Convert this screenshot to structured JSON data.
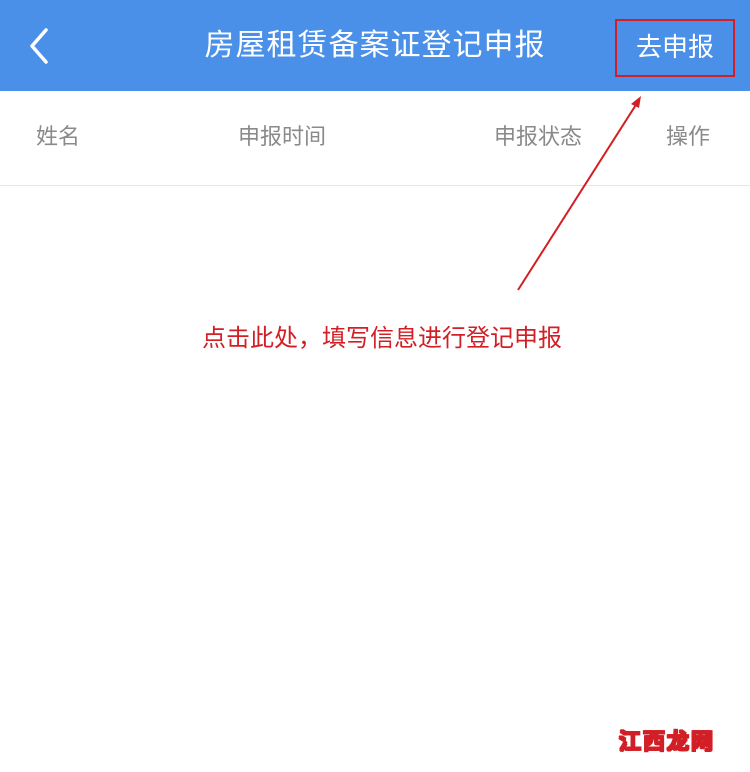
{
  "header": {
    "title": "房屋租赁备案证登记申报",
    "report_button": "去申报",
    "back_icon": "chevron-left-icon",
    "background_color": "#4a90e8"
  },
  "table": {
    "columns": [
      "姓名",
      "申报时间",
      "申报状态",
      "操作"
    ]
  },
  "annotation": {
    "text": "点击此处，填写信息进行登记申报",
    "color": "#d21f26"
  },
  "watermark": {
    "text": "江西龙网"
  }
}
